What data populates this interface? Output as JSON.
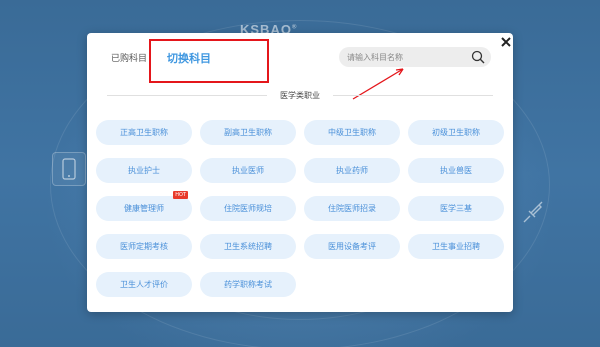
{
  "brand": {
    "name": "KSBAO",
    "mark": "®"
  },
  "modal": {
    "tabs": {
      "bought": "已购科目",
      "switch": "切换科目"
    },
    "search": {
      "placeholder": "请输入科目名称"
    },
    "section_title": "医学类职业",
    "subjects": [
      {
        "label": "正高卫生职称",
        "hot": false
      },
      {
        "label": "副高卫生职称",
        "hot": false
      },
      {
        "label": "中级卫生职称",
        "hot": false
      },
      {
        "label": "初级卫生职称",
        "hot": false
      },
      {
        "label": "执业护士",
        "hot": false
      },
      {
        "label": "执业医师",
        "hot": false
      },
      {
        "label": "执业药师",
        "hot": false
      },
      {
        "label": "执业兽医",
        "hot": false
      },
      {
        "label": "健康管理师",
        "hot": true
      },
      {
        "label": "住院医师规培",
        "hot": false
      },
      {
        "label": "住院医师招录",
        "hot": false
      },
      {
        "label": "医学三基",
        "hot": false
      },
      {
        "label": "医师定期考核",
        "hot": false
      },
      {
        "label": "卫生系统招聘",
        "hot": false
      },
      {
        "label": "医用设备考评",
        "hot": false
      },
      {
        "label": "卫生事业招聘",
        "hot": false
      },
      {
        "label": "卫生人才评价",
        "hot": false
      },
      {
        "label": "药学职称考试",
        "hot": false
      }
    ],
    "hot_badge": "HOT"
  },
  "colors": {
    "accent": "#3f97e0",
    "annotation": "#e4161b",
    "pill_bg": "#e6f1fc"
  },
  "icons": {
    "close": "close-icon",
    "search": "search-icon",
    "phone": "phone-icon",
    "syringe": "syringe-icon"
  }
}
